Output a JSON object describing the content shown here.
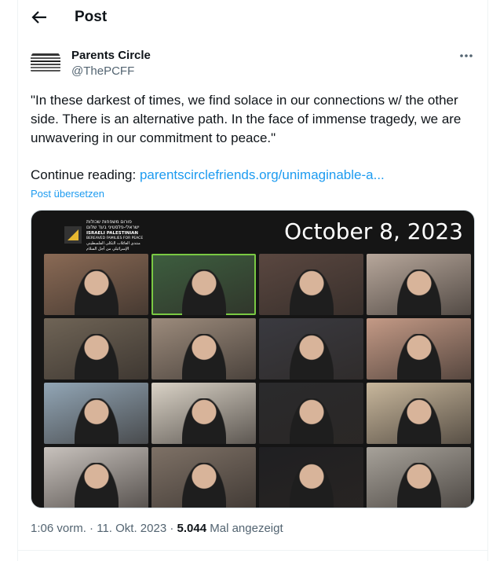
{
  "header": {
    "title": "Post"
  },
  "author": {
    "name": "Parents Circle",
    "handle": "@ThePCFF"
  },
  "tweet": {
    "text": "\"In these darkest of times, we find solace in our connections w/ the other side. There is an alternative path. In the face of immense tragedy, we are unwavering in our commitment to peace.\"",
    "continue_label": "Continue reading:",
    "link_text": "parentscirclefriends.org/unimaginable-a...",
    "translate_label": "Post übersetzen"
  },
  "media": {
    "date_text": "October 8, 2023",
    "logo_lines": [
      "פורום משפחות שכולות",
      "ישראלי-פלסטיני בעד שלום",
      "ISRAELI PALESTINIAN",
      "BEREAVED FAMILIES FOR PEACE",
      "منتدى العائلات الثكلى الفلسطيني",
      "الإسرائيلي من أجل السلام"
    ],
    "tile_colors": [
      "#8a6a55",
      "#3d5e3f",
      "#5a4740",
      "#b7a79b",
      "#6f6456",
      "#9c8b7c",
      "#3a3a40",
      "#c49a86",
      "#92a6b6",
      "#d9d2c6",
      "#2a2a2c",
      "#c8b79c",
      "#c8c2bd",
      "#7e7166",
      "#1f1f22",
      "#a7a29a"
    ]
  },
  "meta": {
    "time": "1:06 vorm.",
    "date": "11. Okt. 2023",
    "views": "5.044",
    "views_label": "Mal angezeigt"
  }
}
